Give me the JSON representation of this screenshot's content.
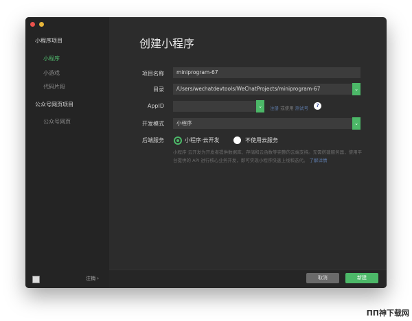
{
  "sidebar": {
    "sections": [
      {
        "label": "小程序项目",
        "items": [
          "小程序",
          "小游戏",
          "代码片段"
        ]
      },
      {
        "label": "公众号网页项目",
        "items": [
          "公众号网页"
        ]
      }
    ],
    "logout": "注销 ›"
  },
  "main": {
    "title": "创建小程序",
    "fields": {
      "name_label": "项目名称",
      "name_value": "miniprogram-67",
      "dir_label": "目录",
      "dir_value": "/Users/wechatdevtools/WeChatProjects/miniprogram-67",
      "appid_label": "AppID",
      "appid_value": "",
      "appid_hint_register": "注册",
      "appid_hint_or": " 或使用 ",
      "appid_hint_test": "测试号",
      "help": "?",
      "mode_label": "开发模式",
      "mode_value": "小程序",
      "backend_label": "后端服务",
      "opt_cloud": "小程序·云开发",
      "opt_none": "不使用云服务"
    },
    "description": "小程序·云开发为开发者提供数据库、存储和云函数等完整的云端支持。无需搭建服务器，使用平台提供的 API 进行核心业务开发，即可实现小程序快速上线和迭代。",
    "learn_more": "了解详情"
  },
  "footer": {
    "cancel": "取消",
    "create": "新建"
  },
  "watermark": "ΠΠ神下载网",
  "colors": {
    "accent": "#4cb868"
  }
}
